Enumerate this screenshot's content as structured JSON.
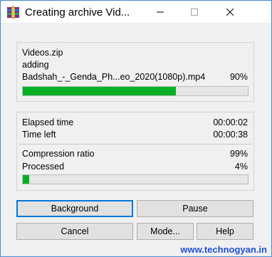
{
  "window": {
    "title": "Creating archive Vid...",
    "minimize_icon": "minimize-icon",
    "maximize_icon": "maximize-icon",
    "close_icon": "close-icon",
    "app_icon": "winrar-icon"
  },
  "archive": {
    "name": "Videos.zip",
    "action": "adding",
    "current_file": "Badshah_-_Genda_Ph...eo_2020(1080p).mp4",
    "file_percent_text": "90%",
    "file_progress": 0.68
  },
  "stats": {
    "elapsed_label": "Elapsed time",
    "elapsed_value": "00:00:02",
    "left_label": "Time left",
    "left_value": "00:00:38",
    "ratio_label": "Compression ratio",
    "ratio_value": "99%",
    "processed_label": "Processed",
    "processed_value": "4%",
    "processed_progress": 0.03
  },
  "buttons": {
    "background": "Background",
    "pause": "Pause",
    "cancel": "Cancel",
    "mode": "Mode...",
    "help": "Help"
  },
  "watermark": "www.technogyan.in",
  "colors": {
    "progress": "#06b025",
    "focus_border": "#0078d7",
    "watermark": "#1f4fd8"
  }
}
